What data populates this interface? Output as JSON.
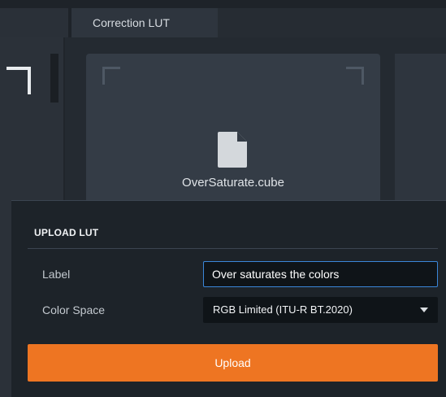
{
  "tabs": {
    "active_label": "Correction LUT"
  },
  "lut_card": {
    "file_name": "OverSaturate.cube"
  },
  "upload_panel": {
    "title": "UPLOAD LUT",
    "label_field": {
      "label": "Label",
      "value": "Over saturates the colors"
    },
    "color_space": {
      "label": "Color Space",
      "selected": "RGB Limited (ITU-R BT.2020)"
    },
    "upload_label": "Upload"
  },
  "colors": {
    "accent": "#ee7522",
    "focus_border": "#3a86d8",
    "background": "#242a31"
  },
  "icons": {
    "file": "file-icon",
    "dropdown": "chevron-down-icon"
  }
}
